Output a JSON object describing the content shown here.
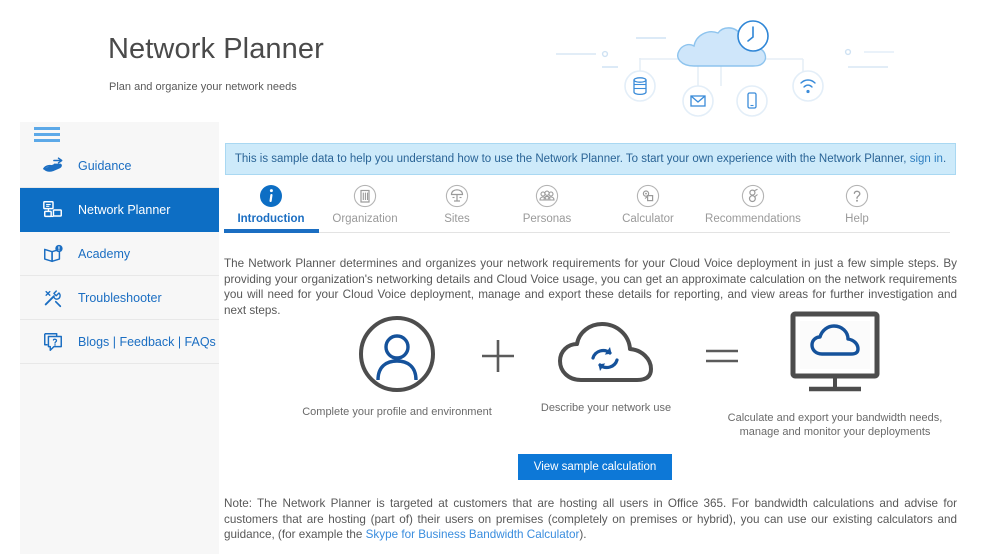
{
  "header": {
    "title": "Network Planner",
    "subtitle": "Plan and organize your network needs",
    "illustration_name": "cloud-network-illustration"
  },
  "sidebar": {
    "hamburger_label": "Menu",
    "items": [
      {
        "label": "Guidance",
        "icon": "guidance-hand-icon",
        "active": false
      },
      {
        "label": "Network Planner",
        "icon": "network-planner-icon",
        "active": true
      },
      {
        "label": "Academy",
        "icon": "academy-book-icon",
        "active": false
      },
      {
        "label": "Troubleshooter",
        "icon": "troubleshooter-tools-icon",
        "active": false
      },
      {
        "label": "Blogs | Feedback | FAQs",
        "icon": "blogs-feedback-icon",
        "active": false
      }
    ]
  },
  "main": {
    "banner": {
      "text_before": "This is sample data to help you understand how to use the Network Planner. To start your own experience with the Network Planner, ",
      "link_text": "sign in",
      "text_after": "."
    },
    "tabs": [
      {
        "label": "Introduction",
        "icon": "info-circle-icon",
        "active": true
      },
      {
        "label": "Organization",
        "icon": "organization-building-icon",
        "active": false
      },
      {
        "label": "Sites",
        "icon": "sites-network-icon",
        "active": false
      },
      {
        "label": "Personas",
        "icon": "personas-people-icon",
        "active": false
      },
      {
        "label": "Calculator",
        "icon": "calculator-icon",
        "active": false
      },
      {
        "label": "Recommendations",
        "icon": "recommendations-icon",
        "active": false
      },
      {
        "label": "Help",
        "icon": "question-mark-icon",
        "active": false
      }
    ],
    "intro_paragraph": "The Network Planner determines and organizes your network requirements for your Cloud Voice deployment in just a few simple steps. By providing your organization's networking details and Cloud Voice usage, you can get an approximate calculation on the network requirements you will need for your Cloud Voice deployment, manage and export these details for reporting, and view areas for further investigation and next steps.",
    "flow": {
      "steps": [
        {
          "icon": "user-profile-circle-icon",
          "caption": "Complete your profile and environment"
        },
        {
          "icon": "cloud-sync-icon",
          "caption": "Describe your network use"
        },
        {
          "icon": "monitor-cloud-icon",
          "caption": "Calculate and export your bandwidth needs,\nmanage and monitor your deployments"
        }
      ],
      "operators": [
        {
          "symbol": "+",
          "name": "plus-operator"
        },
        {
          "symbol": "=",
          "name": "equals-operator"
        }
      ]
    },
    "sample_button_label": "View sample calculation",
    "note": {
      "text_1": "Note: The Network Planner is targeted at customers that are hosting all users in Office 365.  For bandwidth calculations and advise for customers that are hosting (part of) their users on premises (completely on premises or hybrid), you can use our existing calculators and guidance, (for example the ",
      "link_text": "Skype for Business Bandwidth Calculator",
      "text_2": ")."
    }
  },
  "colors": {
    "accent_blue": "#0d6ec4",
    "button_blue": "#0d78d7",
    "banner_bg": "#cdeafa",
    "banner_border": "#a9d8f2",
    "sidebar_bg": "#f7f7f7",
    "link_blue": "#3a8dde",
    "icon_gray": "#4d4d4d"
  }
}
